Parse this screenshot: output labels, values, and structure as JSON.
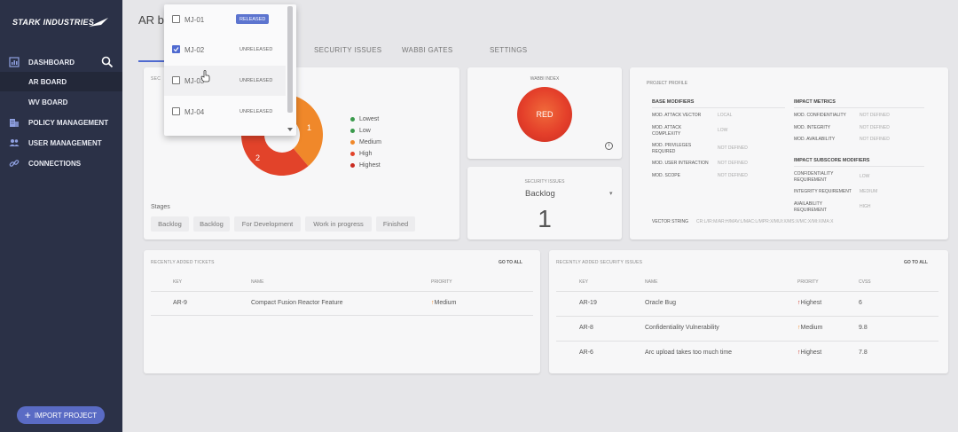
{
  "brand": {
    "name": "STARK INDUSTRIES"
  },
  "sidebar": {
    "items": [
      {
        "label": "DASHBOARD",
        "icon": "dashboard-icon"
      },
      {
        "label": "AR BOARD"
      },
      {
        "label": "WV BOARD"
      },
      {
        "label": "POLICY MANAGEMENT",
        "icon": "building-icon"
      },
      {
        "label": "USER MANAGEMENT",
        "icon": "users-icon"
      },
      {
        "label": "CONNECTIONS",
        "icon": "link-icon"
      }
    ],
    "import_label": "IMPORT PROJECT"
  },
  "header": {
    "title": "AR bo"
  },
  "tabs": [
    {
      "label": "SECURITY ISSUES"
    },
    {
      "label": "WABBI GATES"
    },
    {
      "label": "SETTINGS"
    }
  ],
  "donut": {
    "title": "SEC",
    "legend": [
      {
        "label": "Lowest",
        "color": "#3a9a4c"
      },
      {
        "label": "Low",
        "color": "#3a9a4c"
      },
      {
        "label": "Medium",
        "color": "#f0882a"
      },
      {
        "label": "High",
        "color": "#e2432a"
      },
      {
        "label": "Highest",
        "color": "#c92b20"
      }
    ],
    "slices": [
      {
        "label": "1",
        "value": 1,
        "color": "#f0882a"
      },
      {
        "label": "2",
        "value": 2,
        "color": "#e2432a"
      }
    ],
    "stages_label": "Stages",
    "stages": [
      "Backlog",
      "Backlog",
      "For Development",
      "Work in progress",
      "Finished"
    ]
  },
  "wabbi": {
    "title": "WABBI INDEX",
    "status": "RED",
    "info": "i"
  },
  "security_issues": {
    "title": "SECURITY ISSUES",
    "stage": "Backlog",
    "caret": "▾",
    "count": "1"
  },
  "profile": {
    "title": "PROJECT PROFILE",
    "base_title": "BASE MODIFIERS",
    "base": [
      {
        "key": "MOD. ATTACK VECTOR",
        "value": "LOCAL"
      },
      {
        "key": "MOD. ATTACK COMPLEXITY",
        "value": "LOW"
      },
      {
        "key": "MOD. PRIVILEGES REQUIRED",
        "value": "NOT DEFINED"
      },
      {
        "key": "MOD. USER INTERACTION",
        "value": "NOT DEFINED"
      },
      {
        "key": "MOD. SCOPE",
        "value": "NOT DEFINED"
      }
    ],
    "impact_title": "IMPACT METRICS",
    "impact": [
      {
        "key": "MOD. CONFIDENTIALITY",
        "value": "NOT DEFINED"
      },
      {
        "key": "MOD. INTEGRITY",
        "value": "NOT DEFINED"
      },
      {
        "key": "MOD. AVAILABILITY",
        "value": "NOT DEFINED"
      }
    ],
    "subscore_title": "IMPACT SUBSCORE MODIFIERS",
    "subscore": [
      {
        "key": "CONFIDENTIALITY REQUIREMENT",
        "value": "LOW"
      },
      {
        "key": "INTEGRITY REQUIREMENT",
        "value": "MEDIUM"
      },
      {
        "key": "AVAILABILITY REQUIREMENT",
        "value": "HIGH"
      }
    ],
    "vector_label": "VECTOR STRING",
    "vector_value": "CR:L/IR:M/AR:H/MAV:L/MAC:L/MPR:X/MUI:X/MS:X/MC:X/MI:X/MA:X"
  },
  "tickets": {
    "title": "RECENTLY ADDED TICKETS",
    "goto": "GO TO ALL",
    "columns": [
      "KEY",
      "NAME",
      "PRIORITY"
    ],
    "rows": [
      {
        "key": "AR-9",
        "name": "Compact Fusion Reactor Feature",
        "priority": "Medium",
        "color": "#f0882a"
      }
    ]
  },
  "issues": {
    "title": "RECENTLY ADDED SECURITY ISSUES",
    "goto": "GO TO ALL",
    "columns": [
      "KEY",
      "NAME",
      "PRIORITY",
      "CVSS"
    ],
    "rows": [
      {
        "key": "AR-19",
        "name": "Oracle Bug",
        "priority": "Highest",
        "cvss": "6",
        "color": "#c92b20"
      },
      {
        "key": "AR-8",
        "name": "Confidentiality Vulnerability",
        "priority": "Medium",
        "cvss": "9.8",
        "color": "#f0882a"
      },
      {
        "key": "AR-6",
        "name": "Arc upload takes too much time",
        "priority": "Highest",
        "cvss": "7.8",
        "color": "#c92b20"
      }
    ]
  },
  "dropdown": {
    "items": [
      {
        "label": "MJ-01",
        "status": "RELEASED",
        "checked": false
      },
      {
        "label": "MJ-02",
        "status": "UNRELEASED",
        "checked": true
      },
      {
        "label": "MJ-03",
        "status": "UNRELEASED",
        "checked": false
      },
      {
        "label": "MJ-04",
        "status": "UNRELEASED",
        "checked": false
      }
    ]
  }
}
